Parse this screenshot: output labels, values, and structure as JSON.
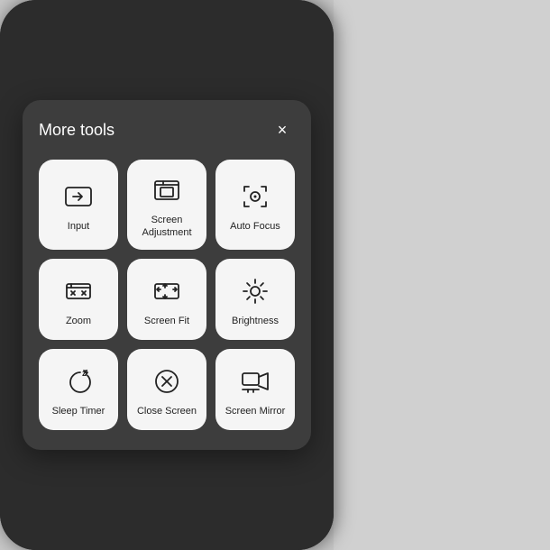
{
  "modal": {
    "title": "More tools",
    "close_label": "×"
  },
  "tools": [
    {
      "id": "input",
      "label": "Input",
      "icon": "input"
    },
    {
      "id": "screen-adjustment",
      "label": "Screen\nAdjustment",
      "icon": "screen-adjustment"
    },
    {
      "id": "auto-focus",
      "label": "Auto Focus",
      "icon": "auto-focus"
    },
    {
      "id": "zoom",
      "label": "Zoom",
      "icon": "zoom"
    },
    {
      "id": "screen-fit",
      "label": "Screen Fit",
      "icon": "screen-fit"
    },
    {
      "id": "brightness",
      "label": "Brightness",
      "icon": "brightness"
    },
    {
      "id": "sleep-timer",
      "label": "Sleep Timer",
      "icon": "sleep-timer"
    },
    {
      "id": "close-screen",
      "label": "Close Screen",
      "icon": "close-screen"
    },
    {
      "id": "screen-mirror",
      "label": "Screen Mirror",
      "icon": "screen-mirror"
    }
  ]
}
